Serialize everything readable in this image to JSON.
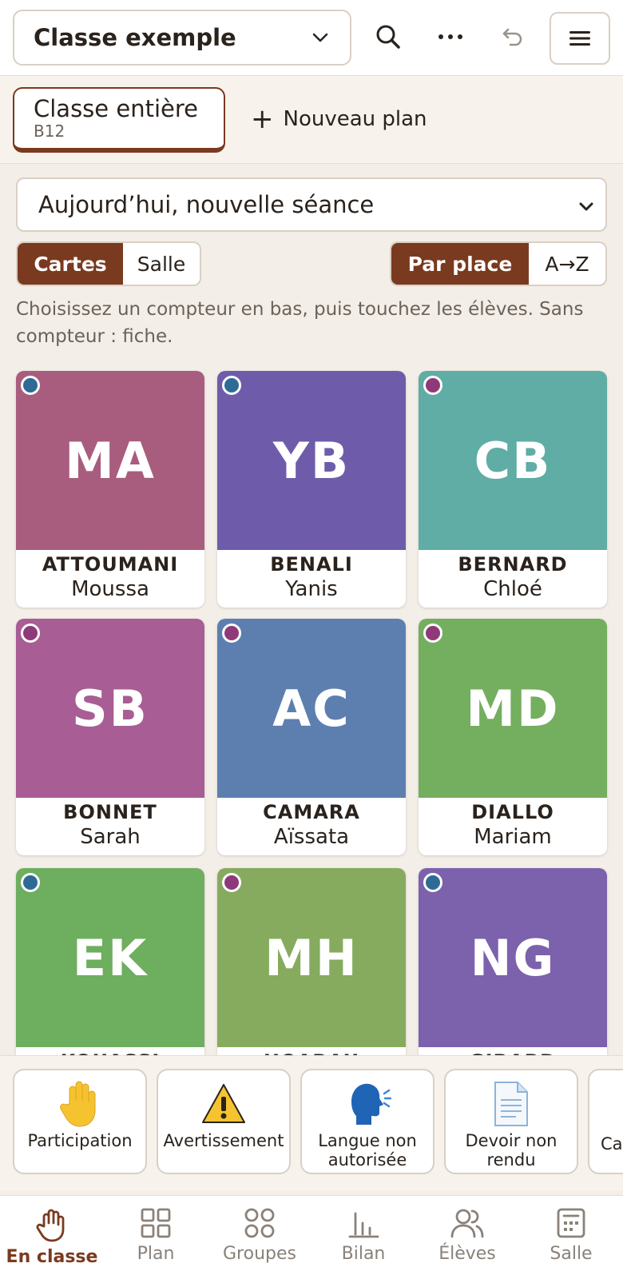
{
  "header": {
    "class_name": "Classe exemple"
  },
  "plans": {
    "active": {
      "name": "Classe entière",
      "room": "B12"
    },
    "new_plan_label": "Nouveau plan",
    "new_plan_symbol": "+"
  },
  "session": {
    "selected": "Aujourd’hui, nouvelle séance"
  },
  "view_toggle": {
    "options": [
      "Cartes",
      "Salle"
    ],
    "active": "Cartes"
  },
  "sort_toggle": {
    "options": [
      "Par place",
      "A→Z"
    ],
    "active": "Par place"
  },
  "hint": "Choisissez un compteur en bas, puis touchez les élèves. Sans compteur : fiche.",
  "students": [
    {
      "initials": "MA",
      "last": "ATTOUMANI",
      "first": "Moussa",
      "color": "#a85d7e",
      "dot": "#2e6b94"
    },
    {
      "initials": "YB",
      "last": "BENALI",
      "first": "Yanis",
      "color": "#6e5cab",
      "dot": "#2e6b94"
    },
    {
      "initials": "CB",
      "last": "BERNARD",
      "first": "Chloé",
      "color": "#5fada5",
      "dot": "#8e3a78"
    },
    {
      "initials": "SB",
      "last": "BONNET",
      "first": "Sarah",
      "color": "#a85d94",
      "dot": "#8e3a78"
    },
    {
      "initials": "AC",
      "last": "CAMARA",
      "first": "Aïssata",
      "color": "#5d7faf",
      "dot": "#8e3a78"
    },
    {
      "initials": "MD",
      "last": "DIALLO",
      "first": "Mariam",
      "color": "#74ae5f",
      "dot": "#8e3a78"
    },
    {
      "initials": "EK",
      "last": "KOUASSI",
      "first": "",
      "color": "#6dae5f",
      "dot": "#2e6b94"
    },
    {
      "initials": "MH",
      "last": "HOARAU",
      "first": "",
      "color": "#86ab5f",
      "dot": "#8e3a78"
    },
    {
      "initials": "NG",
      "last": "GIRARD",
      "first": "",
      "color": "#7c61ad",
      "dot": "#2e6b94"
    }
  ],
  "counters": [
    {
      "label": "Participation",
      "icon": "raised-hand-icon"
    },
    {
      "label": "Avertissement",
      "icon": "warning-icon"
    },
    {
      "label": "Langue non autorisée",
      "icon": "speaking-head-icon"
    },
    {
      "label": "Devoir non rendu",
      "icon": "document-icon"
    },
    {
      "label": "Cal",
      "icon": ""
    }
  ],
  "nav": [
    {
      "label": "En classe",
      "icon": "hand-icon",
      "active": true
    },
    {
      "label": "Plan",
      "icon": "grid-icon"
    },
    {
      "label": "Groupes",
      "icon": "groups-icon"
    },
    {
      "label": "Bilan",
      "icon": "bar-chart-icon"
    },
    {
      "label": "Élèves",
      "icon": "users-icon"
    },
    {
      "label": "Salle",
      "icon": "room-icon"
    }
  ],
  "colors": {
    "accent": "#7a3a1f",
    "background": "#f3eee7"
  }
}
